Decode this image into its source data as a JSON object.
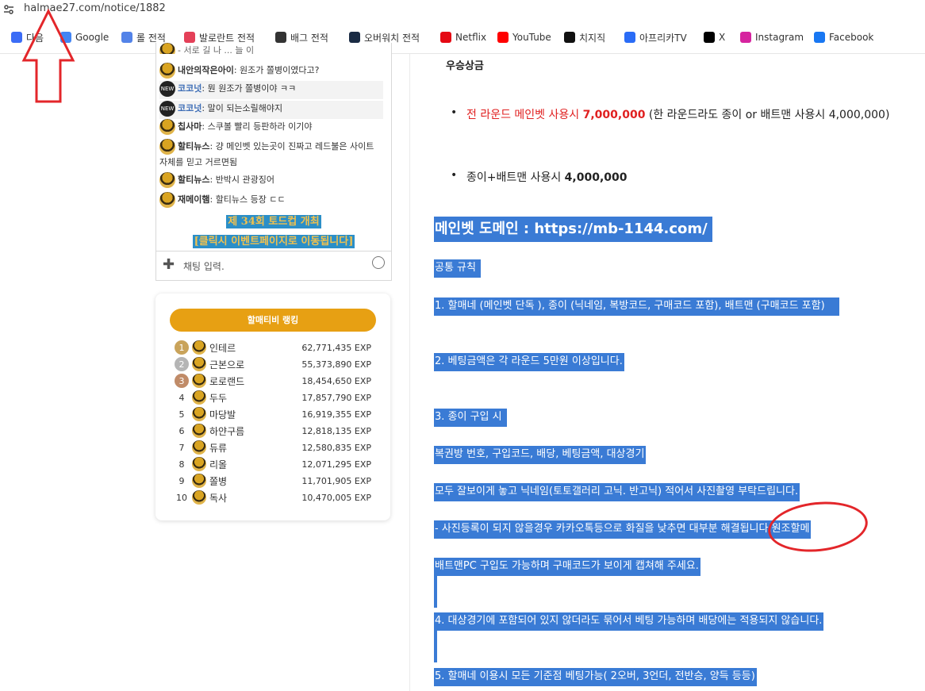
{
  "browser": {
    "url": "halmae27.com/notice/1882",
    "bookmarks": [
      {
        "label": "다음",
        "icon": "daum-icon",
        "color": "#3b6cf6"
      },
      {
        "label": "Google",
        "icon": "google-icon",
        "color": "#4285f4"
      },
      {
        "label": "롤 전적",
        "icon": "op-gg-icon",
        "color": "#5383e8"
      },
      {
        "label": "발로란트 전적",
        "icon": "valorant-stats-icon",
        "color": "#e44058"
      },
      {
        "label": "배그 전적",
        "icon": "pubg-stats-icon",
        "color": "#333333"
      },
      {
        "label": "오버워치 전적",
        "icon": "overwatch-stats-icon",
        "color": "#1a2b44"
      },
      {
        "label": "Netflix",
        "icon": "netflix-icon",
        "color": "#e50914"
      },
      {
        "label": "YouTube",
        "icon": "youtube-icon",
        "color": "#ff0000"
      },
      {
        "label": "치지직",
        "icon": "chzzk-icon",
        "color": "#111111"
      },
      {
        "label": "아프리카TV",
        "icon": "afreecatv-icon",
        "color": "#2a6cf6"
      },
      {
        "label": "X",
        "icon": "x-icon",
        "color": "#000000"
      },
      {
        "label": "Instagram",
        "icon": "instagram-icon",
        "color": "#d6249f"
      },
      {
        "label": "Facebook",
        "icon": "facebook-icon",
        "color": "#1877f2"
      }
    ]
  },
  "chat": {
    "partial_top": "- 서로 길 나 ... 늘 이",
    "messages": [
      {
        "nick": "내안의작은아이",
        "text": "원조가 쫄병이였다고?",
        "highlight": false,
        "nick_style": "dark",
        "avatar": "avatar-icon"
      },
      {
        "nick": "코코넛",
        "text": "뭔 원조가 쫄병이야 ㅋㅋ",
        "highlight": true,
        "nick_style": "blue",
        "avatar": "new-badge-avatar-icon"
      },
      {
        "nick": "코코넛",
        "text": "말이 되는소릴해야지",
        "highlight": true,
        "nick_style": "blue",
        "avatar": "new-badge-avatar-icon"
      },
      {
        "nick": "칩사마",
        "text": "스쿠볼 빨리 등판하라 이기야",
        "highlight": false,
        "nick_style": "dark",
        "avatar": "avatar-icon"
      },
      {
        "nick": "할티뉴스",
        "text": "걍 메인벳 있는곳이 진짜고 레드불은 사이트 자체를 믿고 거르면됨",
        "highlight": false,
        "nick_style": "dark",
        "avatar": "avatar-icon"
      },
      {
        "nick": "할티뉴스",
        "text": "반박시 관광징어",
        "highlight": false,
        "nick_style": "dark",
        "avatar": "avatar-icon"
      },
      {
        "nick": "재메이햄",
        "text": "할티뉴스 등장 ㄷㄷ",
        "highlight": false,
        "nick_style": "dark",
        "avatar": "avatar-icon"
      }
    ],
    "event_line1": "제 34회 토드컵 개최",
    "event_line2": "[클릭시 이벤트페이지로 이동됩니다]",
    "input_placeholder": "채팅 입력."
  },
  "ranking": {
    "title": "할매티비 랭킹",
    "rows": [
      {
        "rank": "1",
        "name": "인테르",
        "exp": "62,771,435 EXP",
        "medal": "#c9a35a"
      },
      {
        "rank": "2",
        "name": "근본으로",
        "exp": "55,373,890 EXP",
        "medal": "#b5b5b5"
      },
      {
        "rank": "3",
        "name": "로로랜드",
        "exp": "18,454,650 EXP",
        "medal": "#c08b68"
      },
      {
        "rank": "4",
        "name": "두두",
        "exp": "17,857,790 EXP",
        "medal": ""
      },
      {
        "rank": "5",
        "name": "마당발",
        "exp": "16,919,355 EXP",
        "medal": ""
      },
      {
        "rank": "6",
        "name": "하얀구름",
        "exp": "12,818,135 EXP",
        "medal": ""
      },
      {
        "rank": "7",
        "name": "듀류",
        "exp": "12,580,835 EXP",
        "medal": ""
      },
      {
        "rank": "8",
        "name": "리올",
        "exp": "12,071,295 EXP",
        "medal": ""
      },
      {
        "rank": "9",
        "name": "쫄병",
        "exp": "11,701,905 EXP",
        "medal": ""
      },
      {
        "rank": "10",
        "name": "독사",
        "exp": "10,470,005 EXP",
        "medal": ""
      }
    ]
  },
  "notice": {
    "prize_heading": "우승상금",
    "bullet1_red": "전 라운드 메인벳 사용시 ",
    "bullet1_amount": "7,000,000",
    "bullet1_rest": " (한 라운드라도 종이 or 배트맨 사용시 4,000,000)",
    "bullet2_text": "종이+배트맨 사용시 ",
    "bullet2_amount": "4,000,000",
    "domain_line": "메인벳 도메인 : https://mb-1144.com/",
    "rules_title": "공통 규칙",
    "rule1": "1. 할매네 (메인벳 단독 ), 종이 (닉네임, 복방코드, 구매코드 포함),  배트맨 (구매코드 포함)",
    "rule2": "2. 베팅금액은 각 라운드 5만원 이상입니다.",
    "rule3": "3. 종이 구입 시",
    "rule3_sub1": "복권방 번호, 구입코드, 배당, 베팅금액, 대상경기",
    "rule3_sub2": "모두 잘보이게 놓고 닉네임(토토갤러리 고닉. 반고닉) 적어서 사진촬영 부탁드립니다.",
    "rule3_sub3": " - 사진등록이 되지 않을경우 카카오톡등으로 화질을 낮추면 대부분 해결됩니다.원조할메",
    "rule3_sub4": "배트맨PC 구입도 가능하며 구매코드가 보이게 캡쳐해 주세요.",
    "rule4": "4. 대상경기에 포함되어 있지 않더라도 묶어서 베팅 가능하며 배당에는 적용되지 않습니다.",
    "rule5": "5. 할매네 이용시 모든 기준점 베팅가능( 2오버, 3언더, 전반승, 양득 등등)"
  },
  "colors": {
    "selection": "#3a7bd5",
    "annotation_red": "#e3262a",
    "rank_header": "#e7a013"
  }
}
